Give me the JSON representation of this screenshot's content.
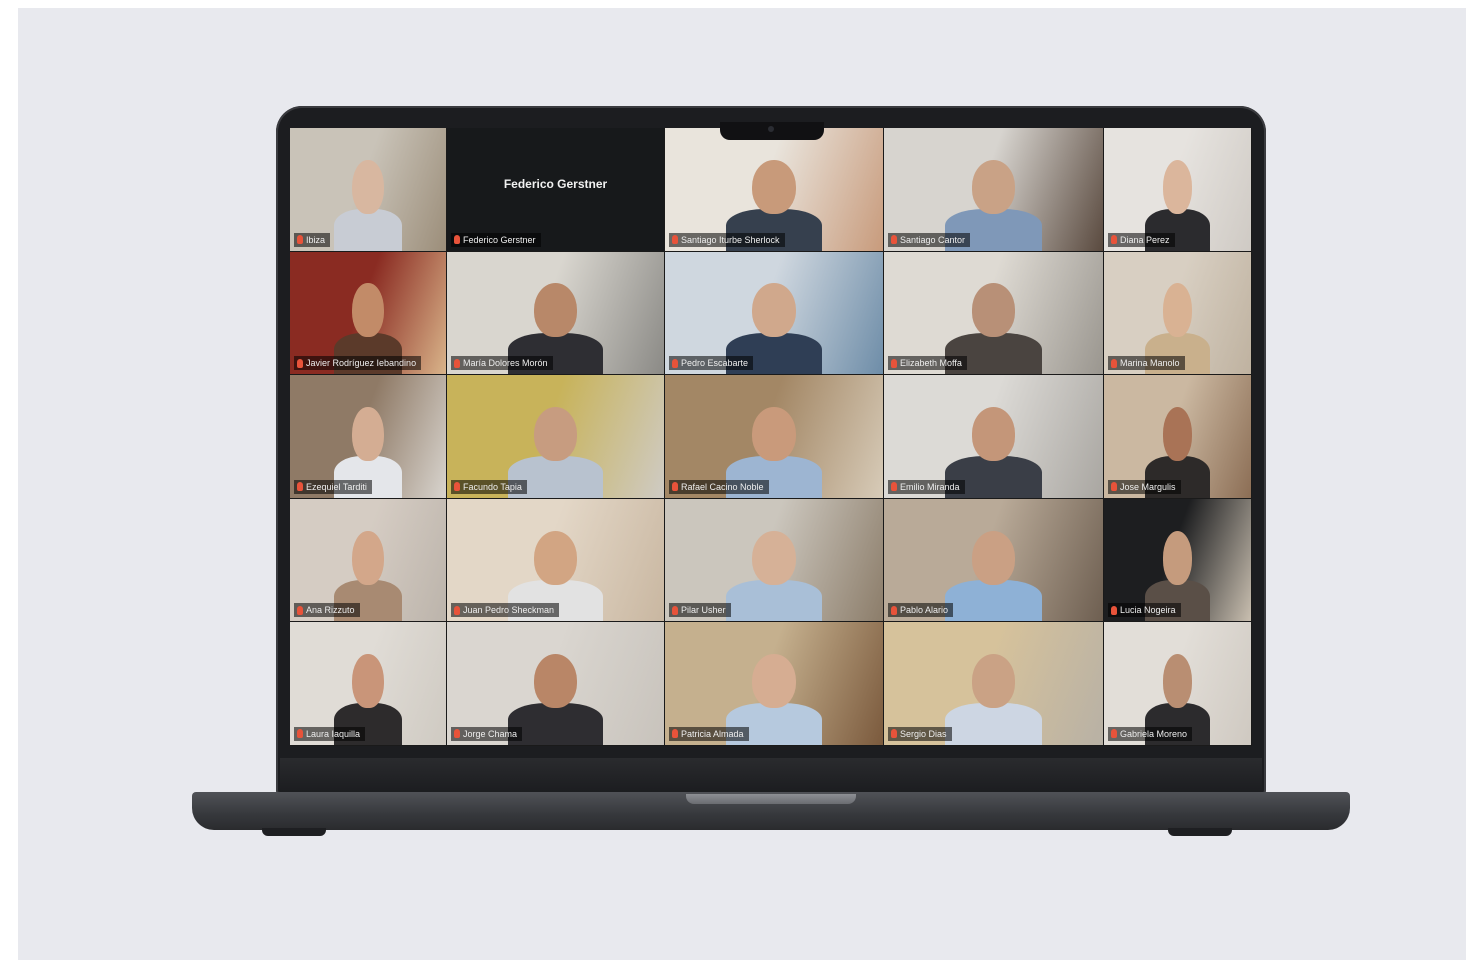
{
  "meeting": {
    "accent_color": "#2fd0a3",
    "muted_icon": "mic-muted-icon",
    "tiles": [
      {
        "name": "Ibiza",
        "bg": [
          "#c9c3b8",
          "#9c8e7a"
        ],
        "skin": "#d8b7a0",
        "shirt": "#c8ccd4",
        "active": true
      },
      {
        "name": "Federico Gerstner",
        "camera_off": true,
        "display_name": "Federico Gerstner"
      },
      {
        "name": "Santiago Iturbe Sherlock",
        "bg": [
          "#e9e4dc",
          "#c89b7c"
        ],
        "skin": "#c89a7a",
        "shirt": "#36404e"
      },
      {
        "name": "Santiago Cantor",
        "bg": [
          "#d7d4cf",
          "#5a4a3f"
        ],
        "skin": "#c9a286",
        "shirt": "#7f98b8"
      },
      {
        "name": "Diana Perez",
        "bg": [
          "#e6e3df",
          "#cfcac4"
        ],
        "skin": "#dbb69c",
        "shirt": "#2b2b2e"
      },
      {
        "name": "Javier Rodríguez Iebandino",
        "bg": [
          "#8a2b22",
          "#d9b48a"
        ],
        "skin": "#c28b68",
        "shirt": "#5b3a2a"
      },
      {
        "name": "María Dolores Morón",
        "bg": [
          "#d9d6cf",
          "#8b8a86"
        ],
        "skin": "#b88869",
        "shirt": "#2e2e33"
      },
      {
        "name": "Pedro Escabarte",
        "bg": [
          "#cfd7df",
          "#6e8da8"
        ],
        "skin": "#d0a88c",
        "shirt": "#2f3e55"
      },
      {
        "name": "Elizabeth Moffa",
        "bg": [
          "#dedad3",
          "#9a968f"
        ],
        "skin": "#b89077",
        "shirt": "#4a4440"
      },
      {
        "name": "Marina Manolo",
        "bg": [
          "#d8cfc2",
          "#bfb2a0"
        ],
        "skin": "#d9b293",
        "shirt": "#c9b08c"
      },
      {
        "name": "Ezequiel Tarditi",
        "bg": [
          "#8f7a66",
          "#d8d4ce"
        ],
        "skin": "#d4ad93",
        "shirt": "#e4e6ea"
      },
      {
        "name": "Facundo Tapia",
        "bg": [
          "#c8b35a",
          "#cfcbc4"
        ],
        "skin": "#c79c80",
        "shirt": "#b8c2cf"
      },
      {
        "name": "Rafael Cacino Noble",
        "bg": [
          "#a38765",
          "#d7cbb8"
        ],
        "skin": "#c99a7b",
        "shirt": "#9db5d2"
      },
      {
        "name": "Emilio Miranda",
        "bg": [
          "#dcdad6",
          "#a9a6a1"
        ],
        "skin": "#c49679",
        "shirt": "#3a3e47"
      },
      {
        "name": "Jose Margulis",
        "bg": [
          "#cbb8a1",
          "#8c6e55"
        ],
        "skin": "#a97356",
        "shirt": "#2d2a29"
      },
      {
        "name": "Ana Rizzuto",
        "bg": [
          "#d5ccc3",
          "#bcb4ab"
        ],
        "skin": "#d3a78a",
        "shirt": "#a88a72"
      },
      {
        "name": "Juan Pedro Sheckman",
        "bg": [
          "#e3d7c7",
          "#c9b7a1"
        ],
        "skin": "#d2a583",
        "shirt": "#e2e2e2"
      },
      {
        "name": "Pilar Usher",
        "bg": [
          "#cbc6bd",
          "#8c7d6a"
        ],
        "skin": "#d6b197",
        "shirt": "#a9bfd7"
      },
      {
        "name": "Pablo Alario",
        "bg": [
          "#b9aa98",
          "#6e5f51"
        ],
        "skin": "#caa084",
        "shirt": "#8eb1d6"
      },
      {
        "name": "Lucia Nogeira",
        "bg": [
          "#1d1e20",
          "#c9bfb0"
        ],
        "skin": "#c59b7d",
        "shirt": "#5a4f47"
      },
      {
        "name": "Laura Iaquilla",
        "bg": [
          "#e0dcd6",
          "#cfcac2"
        ],
        "skin": "#c99579",
        "shirt": "#2d2b2c"
      },
      {
        "name": "Jorge Chama",
        "bg": [
          "#dad6d0",
          "#c8c3bc"
        ],
        "skin": "#b98667",
        "shirt": "#2e2d31"
      },
      {
        "name": "Patricia Almada",
        "bg": [
          "#c5b08e",
          "#7b5a3d"
        ],
        "skin": "#d6ad92",
        "shirt": "#b6c9de"
      },
      {
        "name": "Sergio Dias",
        "bg": [
          "#d6c29b",
          "#b8b1a5"
        ],
        "skin": "#caa285",
        "shirt": "#cdd6e3"
      },
      {
        "name": "Gabriela Moreno",
        "bg": [
          "#e2ded8",
          "#cfc9c1"
        ],
        "skin": "#b98e72",
        "shirt": "#2c2b2d"
      }
    ]
  }
}
